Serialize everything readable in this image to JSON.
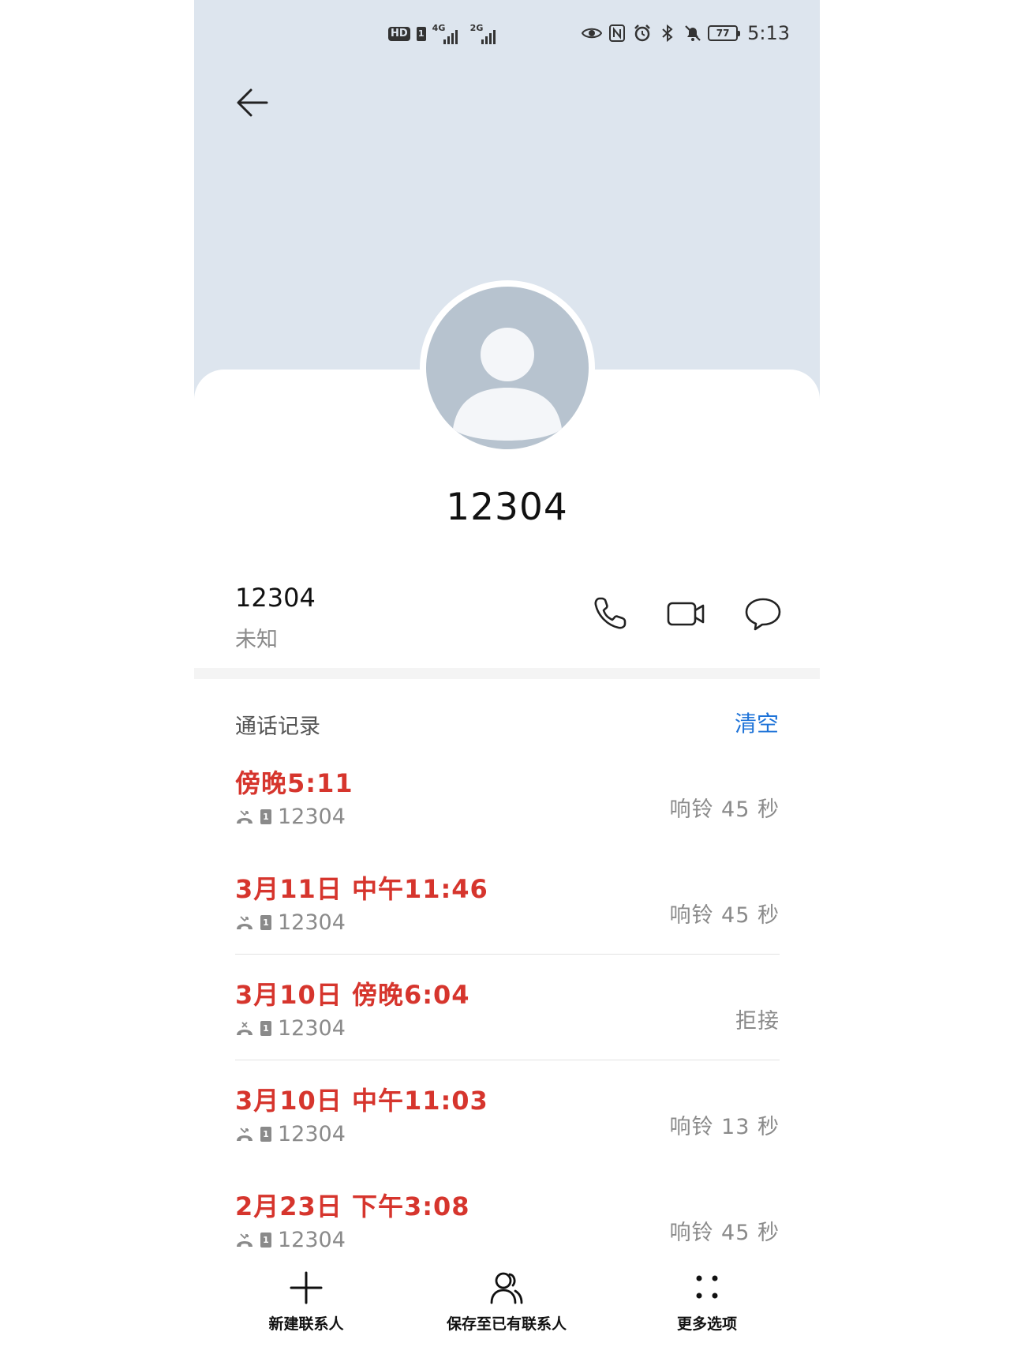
{
  "status_bar": {
    "hd": "HD",
    "sim1": "1",
    "signal1_label": "4G",
    "signal2_label": "2G",
    "battery": "77",
    "time": "5:13"
  },
  "contact": {
    "name": "12304",
    "number": "12304",
    "location": "未知"
  },
  "history": {
    "title": "通话记录",
    "clear_label": "清空",
    "entries": [
      {
        "time": "傍晚5:11",
        "sim": "1",
        "number": "12304",
        "duration": "响铃 45 秒"
      },
      {
        "time": "3月11日 中午11:46",
        "sim": "1",
        "number": "12304",
        "duration": "响铃 45 秒"
      },
      {
        "time": "3月10日 傍晚6:04",
        "sim": "1",
        "number": "12304",
        "duration": "拒接"
      },
      {
        "time": "3月10日 中午11:03",
        "sim": "1",
        "number": "12304",
        "duration": "响铃 13 秒"
      },
      {
        "time": "2月23日 下午3:08",
        "sim": "1",
        "number": "12304",
        "duration": "响铃 45 秒"
      }
    ]
  },
  "bottom_bar": {
    "new_contact": "新建联系人",
    "save_existing": "保存至已有联系人",
    "more_options": "更多选项"
  },
  "colors": {
    "header_bg": "#dde5ee",
    "missed_red": "#d6352d",
    "accent_blue": "#1e73d8",
    "avatar_gray": "#b7c3cf"
  }
}
